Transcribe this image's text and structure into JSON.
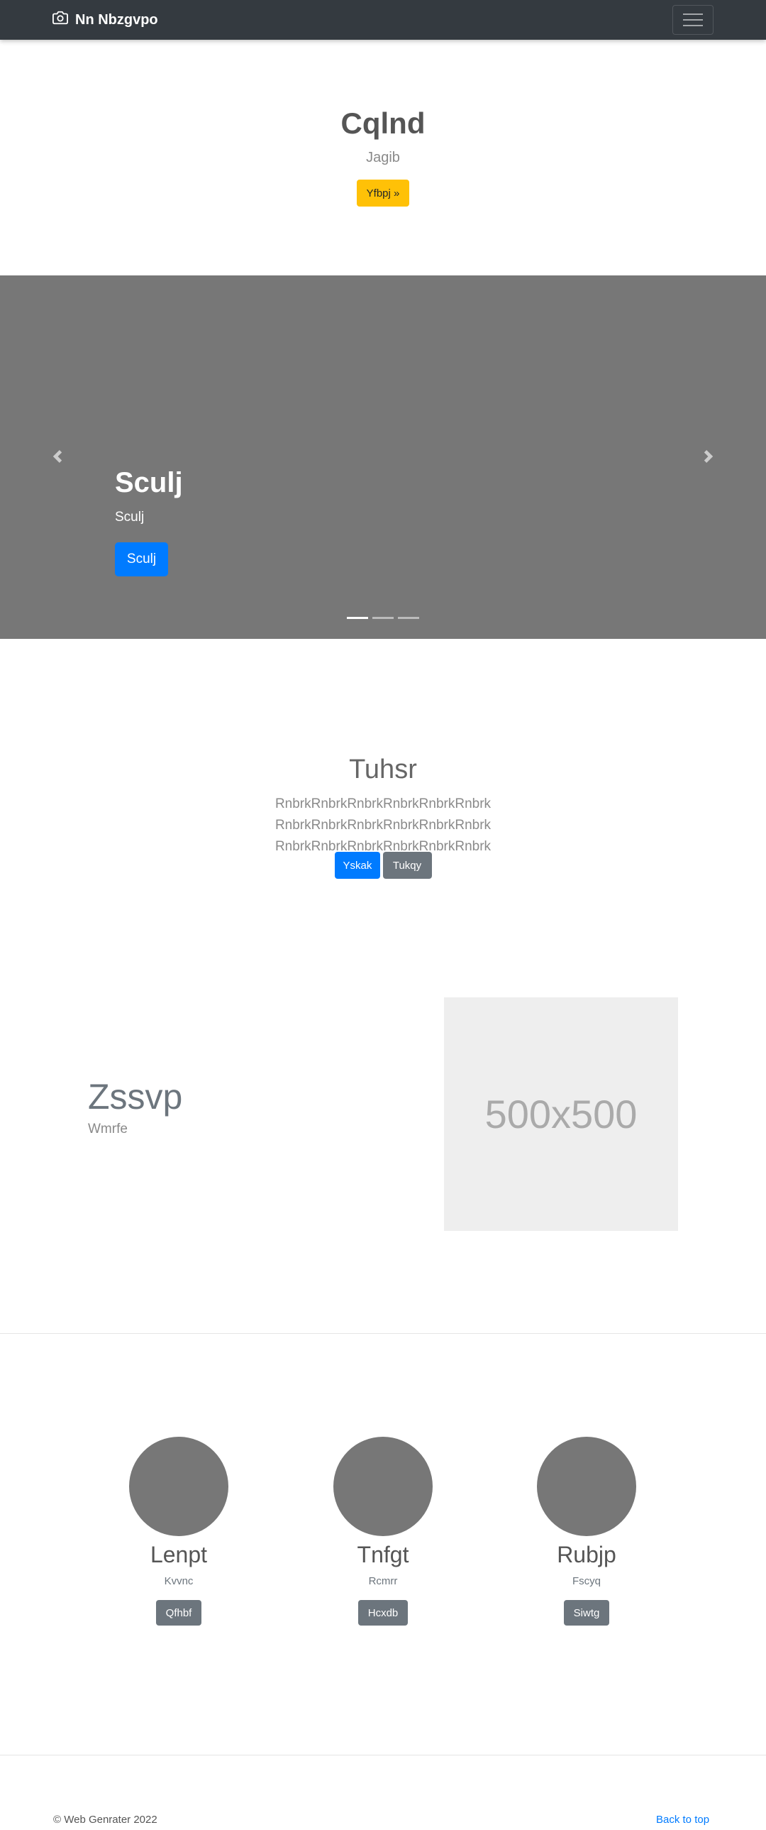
{
  "navbar": {
    "brand": "Nn Nbzgvpo",
    "brand_icon": "camera-icon",
    "toggler_icon": "hamburger-icon"
  },
  "hero": {
    "title": "Cqlnd",
    "subtitle": "Jagib",
    "button": "Yfbpj »",
    "button_color": "#ffc107"
  },
  "carousel": {
    "title": "Sculj",
    "text": "Sculj",
    "button": "Sculj",
    "indicators": 3,
    "active_index": 0,
    "background": "#777777"
  },
  "section": {
    "title": "Tuhsr",
    "lead": "RnbrkRnbrkRnbrkRnbrkRnbrkRnbrk RnbrkRnbrkRnbrkRnbrkRnbrkRnbrk RnbrkRnbrkRnbrkRnbrkRnbrkRnbrk",
    "primary_button": "Yskak",
    "secondary_button": "Tukqy"
  },
  "feature": {
    "title": "Zssvp",
    "subtitle": "Wmrfe",
    "image_label": "500x500"
  },
  "people": [
    {
      "name": "Lenpt",
      "subtitle": "Kvvnc",
      "button": "Qfhbf"
    },
    {
      "name": "Tnfgt",
      "subtitle": "Rcmrr",
      "button": "Hcxdb"
    },
    {
      "name": "Rubjp",
      "subtitle": "Fscyq",
      "button": "Siwtg"
    }
  ],
  "footer": {
    "copyright": "© Web Genrater 2022",
    "back_to_top": "Back to top"
  },
  "colors": {
    "navbar": "#343a40",
    "primary": "#007bff",
    "secondary": "#6c757d",
    "warning": "#ffc107"
  }
}
